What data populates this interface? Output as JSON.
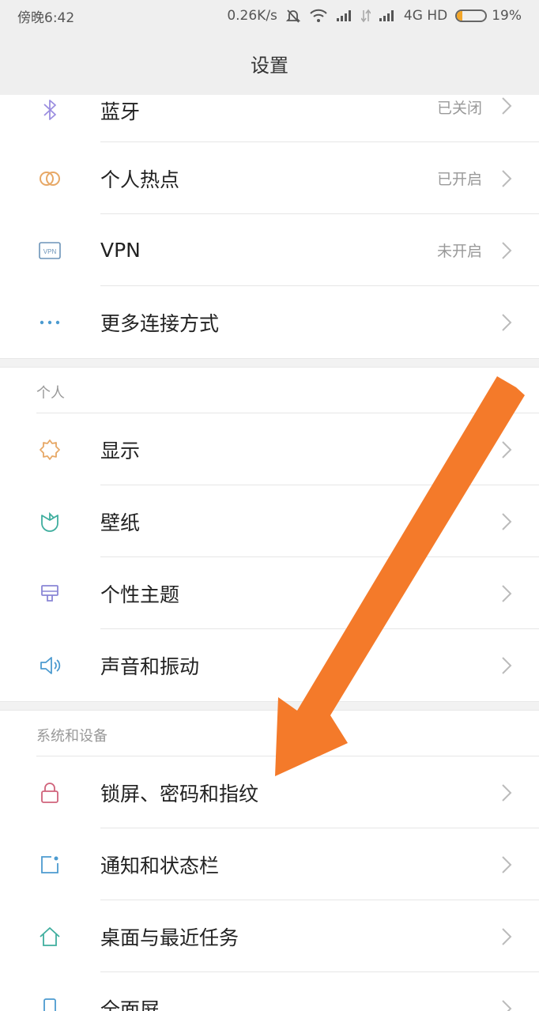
{
  "status_bar": {
    "time": "傍晚6:42",
    "net_speed": "0.26K/s",
    "network": "4G HD",
    "battery_pct": "19%",
    "battery_level": 0.19,
    "battery_color": "#f3a629"
  },
  "header": {
    "title": "设置"
  },
  "connection": {
    "items": [
      {
        "label": "蓝牙",
        "value": "已关闭",
        "icon": "bluetooth-icon"
      },
      {
        "label": "个人热点",
        "value": "已开启",
        "icon": "hotspot-icon"
      },
      {
        "label": "VPN",
        "value": "未开启",
        "icon": "vpn-icon",
        "icon_text": "VPN"
      },
      {
        "label": "更多连接方式",
        "value": "",
        "icon": "more-dots-icon"
      }
    ]
  },
  "personal": {
    "header": "个人",
    "items": [
      {
        "label": "显示",
        "icon": "display-sun-icon"
      },
      {
        "label": "壁纸",
        "icon": "wallpaper-flower-icon"
      },
      {
        "label": "个性主题",
        "icon": "theme-brush-icon"
      },
      {
        "label": "声音和振动",
        "icon": "speaker-icon"
      }
    ]
  },
  "system": {
    "header": "系统和设备",
    "items": [
      {
        "label": "锁屏、密码和指纹",
        "icon": "lock-icon"
      },
      {
        "label": "通知和状态栏",
        "icon": "notification-icon"
      },
      {
        "label": "桌面与最近任务",
        "icon": "home-icon"
      },
      {
        "label": "全面屏",
        "icon": "fullscreen-phone-icon"
      }
    ]
  },
  "annotation": {
    "arrow_color": "#f47a2a"
  }
}
